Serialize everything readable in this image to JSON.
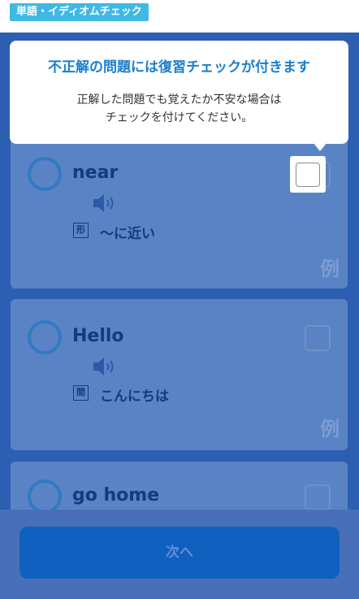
{
  "header": {
    "tag": "単語・イディオムチェック"
  },
  "tooltip": {
    "title": "不正解の問題には復習チェックが付きます",
    "body_line1": "正解した問題でも覚えたか不安な場合は",
    "body_line2": "チェックを付けてください。"
  },
  "cards": [
    {
      "word": "near",
      "pos": "形",
      "meaning": "～に近い",
      "example": "例"
    },
    {
      "word": "Hello",
      "pos": "間",
      "meaning": "こんにちは",
      "example": "例"
    },
    {
      "word": "go home"
    }
  ],
  "footer": {
    "next_label": "次へ"
  },
  "colors": {
    "accent": "#3fb8e4",
    "background": "#2c5fb2",
    "card": "#5a83c6",
    "button": "#1060c0"
  },
  "icons": {
    "speaker": "speaker-icon",
    "ring": "circle-mark-icon",
    "checkbox": "checkbox-icon"
  }
}
